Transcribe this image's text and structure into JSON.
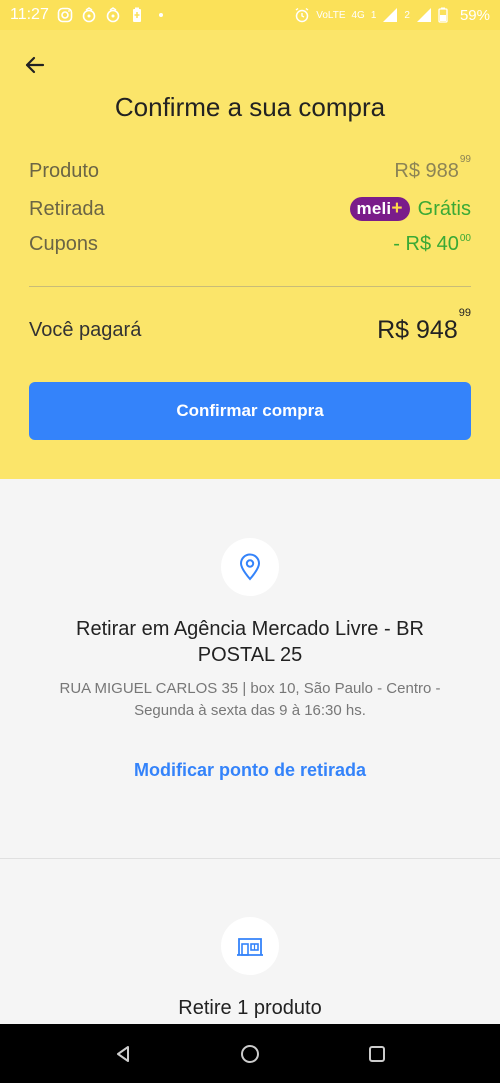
{
  "status_bar": {
    "time": "11:27",
    "battery": "59%",
    "network_label": "4G",
    "sim_indicator": "1",
    "sim_indicator_2": "2",
    "volte_label": "VoLTE",
    "icons": [
      "instagram-icon",
      "notification-icon",
      "notification-icon",
      "battery-saver-icon",
      "dot-icon",
      "alarm-icon",
      "signal-icon",
      "wifi-icon",
      "battery-icon"
    ]
  },
  "header": {
    "title": "Confirme a sua compra"
  },
  "summary": {
    "product_label": "Produto",
    "product_price": "R$ 988",
    "product_cents": "99",
    "pickup_label": "Retirada",
    "meli_badge": "meli",
    "meli_plus": "+",
    "pickup_value": "Grátis",
    "coupons_label": "Cupons",
    "coupons_value": "- R$ 40",
    "coupons_cents": "00"
  },
  "total": {
    "label": "Você pagará",
    "value": "R$ 948",
    "cents": "99"
  },
  "confirm_button": "Confirmar compra",
  "pickup": {
    "title": "Retirar em Agência Mercado Livre - BR POSTAL 25",
    "address": "RUA MIGUEL CARLOS 35 | box 10, São Paulo - Centro - Segunda à sexta das 9 à 16:30 hs.",
    "modify_link": "Modificar ponto de retirada"
  },
  "products": {
    "label": "Retire 1 produto"
  },
  "colors": {
    "brand_yellow": "#fbe56a",
    "accent_blue": "#3483fa",
    "green": "#3aa935",
    "meli_purple": "#7a1c8a"
  }
}
